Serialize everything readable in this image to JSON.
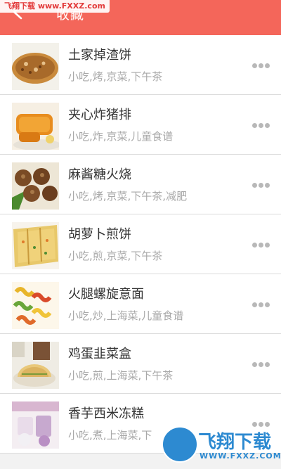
{
  "header": {
    "title": "收藏",
    "watermark": "飞翔下载 www.FXXZ.com"
  },
  "list": [
    {
      "title": "土家掉渣饼",
      "tags": "小吃,烤,京菜,下午茶"
    },
    {
      "title": "夹心炸猪排",
      "tags": "小吃,炸,京菜,儿童食谱"
    },
    {
      "title": "麻酱糖火烧",
      "tags": "小吃,烤,京菜,下午茶,减肥"
    },
    {
      "title": "胡萝卜煎饼",
      "tags": "小吃,煎,京菜,下午茶"
    },
    {
      "title": "火腿螺旋意面",
      "tags": "小吃,炒,上海菜,儿童食谱"
    },
    {
      "title": "鸡蛋韭菜盒",
      "tags": "小吃,煎,上海菜,下午茶"
    },
    {
      "title": "香芋西米冻糕",
      "tags": "小吃,煮,上海菜,下"
    }
  ],
  "bottom_watermark": {
    "name": "飞翔下载",
    "url": "WWW.FXXZ.COM"
  },
  "colors": {
    "header_bg": "#f4665a",
    "more_dots": "#b8b8b8"
  }
}
